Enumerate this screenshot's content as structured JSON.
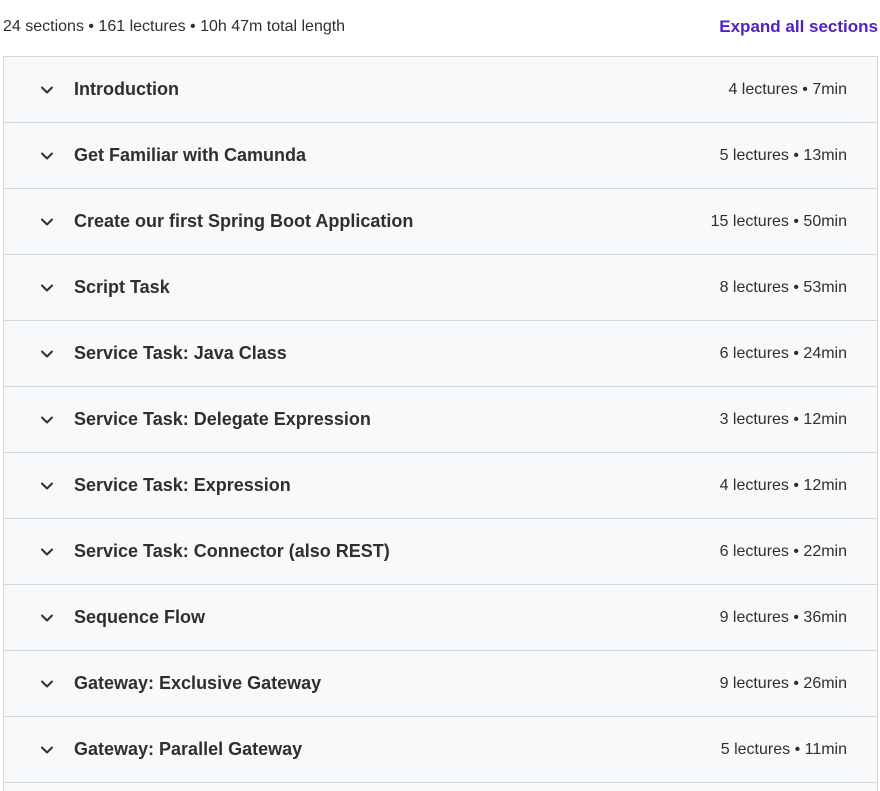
{
  "summary": {
    "text": "24 sections • 161 lectures • 10h 47m total length",
    "expand_label": "Expand all sections"
  },
  "sections": [
    {
      "title": "Introduction",
      "meta": "4 lectures • 7min"
    },
    {
      "title": "Get Familiar with Camunda",
      "meta": "5 lectures • 13min"
    },
    {
      "title": "Create our first Spring Boot Application",
      "meta": "15 lectures • 50min"
    },
    {
      "title": "Script Task",
      "meta": "8 lectures • 53min"
    },
    {
      "title": "Service Task: Java Class",
      "meta": "6 lectures • 24min"
    },
    {
      "title": "Service Task: Delegate Expression",
      "meta": "3 lectures • 12min"
    },
    {
      "title": "Service Task: Expression",
      "meta": "4 lectures • 12min"
    },
    {
      "title": "Service Task: Connector (also REST)",
      "meta": "6 lectures • 22min"
    },
    {
      "title": "Sequence Flow",
      "meta": "9 lectures • 36min"
    },
    {
      "title": "Gateway: Exclusive Gateway",
      "meta": "9 lectures • 26min"
    },
    {
      "title": "Gateway: Parallel Gateway",
      "meta": "5 lectures • 11min"
    }
  ],
  "icons": {
    "chevron": "chevron-down-icon"
  },
  "colors": {
    "accent": "#5022c3",
    "row_background": "#f7f9fa",
    "border": "#d1d7dc",
    "text": "#2d2f31"
  }
}
